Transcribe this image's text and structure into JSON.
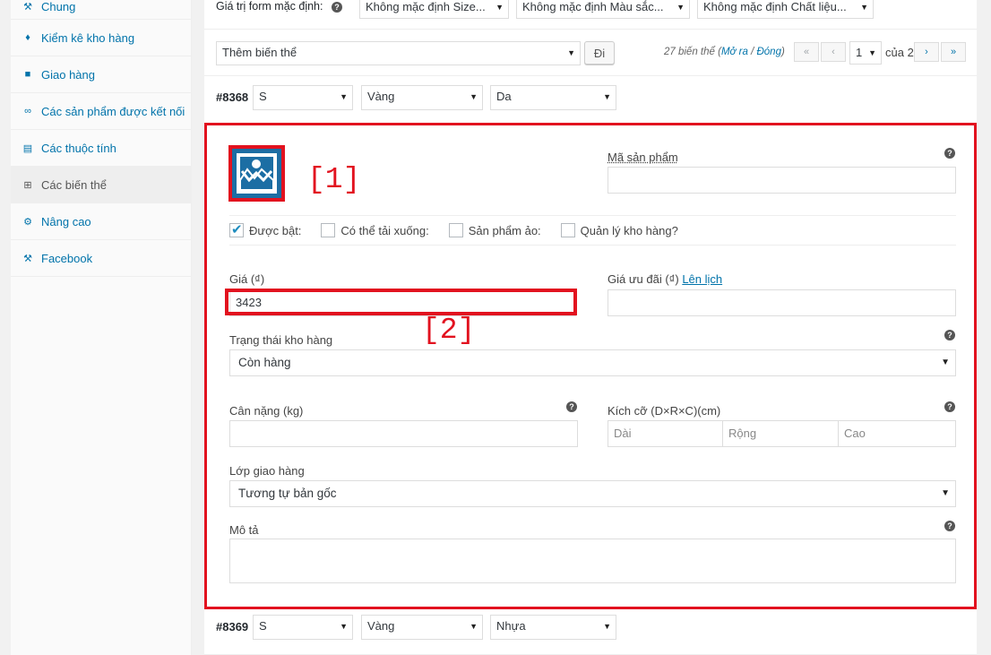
{
  "sidebar": {
    "items": [
      {
        "label": "Chung",
        "icon": "wrench-icon"
      },
      {
        "label": "Kiểm kê kho hàng",
        "icon": "tag-icon"
      },
      {
        "label": "Giao hàng",
        "icon": "truck-icon"
      },
      {
        "label": "Các sản phẩm được kết nối",
        "icon": "link-icon"
      },
      {
        "label": "Các thuộc tính",
        "icon": "table-icon"
      },
      {
        "label": "Các biến thể",
        "icon": "grid-icon"
      },
      {
        "label": "Nâng cao",
        "icon": "gear-icon"
      },
      {
        "label": "Facebook",
        "icon": "wrench-icon"
      }
    ],
    "active_index": 5
  },
  "defaults": {
    "label": "Giá trị form mặc định:",
    "size": "Không mặc định Size...",
    "color": "Không mặc định Màu sắc...",
    "material": "Không mặc định Chất liệu..."
  },
  "toolbar": {
    "action_select": "Thêm biến thể",
    "go_label": "Đi",
    "count_text": "27 biến thể (",
    "expand_link": "Mở ra",
    "sep": " / ",
    "collapse_link": "Đóng",
    "count_close": ")",
    "first": "«",
    "prev": "‹",
    "page": "1",
    "of_label": "của 2",
    "next": "›",
    "last": "»"
  },
  "variation_1": {
    "id": "#8368",
    "size": "S",
    "color": "Vàng",
    "material": "Da"
  },
  "variation_2": {
    "id": "#8369",
    "size": "S",
    "color": "Vàng",
    "material": "Nhựa"
  },
  "annotations": {
    "one": "[1]",
    "two": "[2]"
  },
  "form": {
    "sku_label": "Mã sản phẩm",
    "sku_value": "",
    "enabled_label": "Được bật:",
    "downloadable_label": "Có thể tải xuống:",
    "virtual_label": "Sản phẩm ảo:",
    "manage_stock_label": "Quản lý kho hàng?",
    "enabled": true,
    "downloadable": false,
    "virtual": false,
    "manage_stock": false,
    "price_label": "Giá (₫)",
    "price_value": "3423",
    "sale_price_label": "Giá ưu đãi (₫)",
    "schedule_link": "Lên lịch",
    "sale_price_value": "",
    "stock_status_label": "Trạng thái kho hàng",
    "stock_status_value": "Còn hàng",
    "weight_label": "Cân nặng (kg)",
    "weight_value": "",
    "dimensions_label": "Kích cỡ (D×R×C)(cm)",
    "length_placeholder": "Dài",
    "width_placeholder": "Rộng",
    "height_placeholder": "Cao",
    "shipping_class_label": "Lớp giao hàng",
    "shipping_class_value": "Tương tự bản gốc",
    "description_label": "Mô tả",
    "description_value": ""
  },
  "colors": {
    "accent": "#0073aa",
    "annotation": "#e2121f"
  }
}
